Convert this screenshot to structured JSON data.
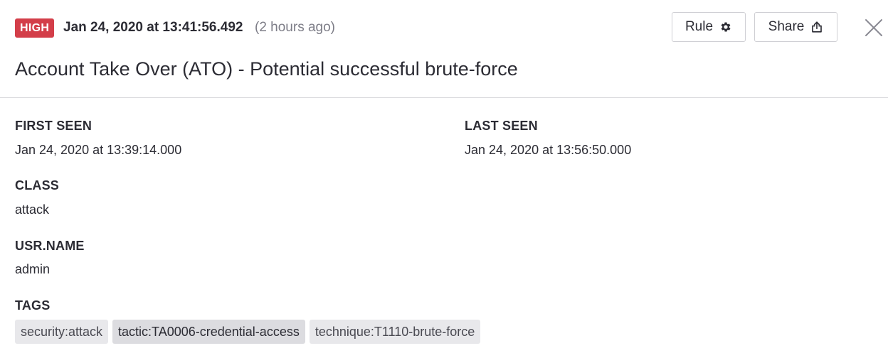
{
  "header": {
    "severity": "HIGH",
    "timestamp": "Jan 24, 2020 at 13:41:56.492",
    "relative_time": "(2 hours ago)",
    "rule_button": "Rule",
    "share_button": "Share",
    "title": "Account Take Over (ATO) - Potential successful brute-force",
    "colors": {
      "severity_high": "#d33e49"
    },
    "icons": {
      "rule": "gear-icon",
      "share": "share-icon",
      "close": "close-icon"
    }
  },
  "fields": {
    "first_seen": {
      "label": "FIRST SEEN",
      "value": "Jan 24, 2020 at 13:39:14.000"
    },
    "last_seen": {
      "label": "LAST SEEN",
      "value": "Jan 24, 2020 at 13:56:50.000"
    },
    "class": {
      "label": "CLASS",
      "value": "attack"
    },
    "usr_name": {
      "label": "USR.NAME",
      "value": "admin"
    },
    "tags": {
      "label": "TAGS",
      "items": [
        "security:attack",
        "tactic:TA0006-credential-access",
        "technique:T1110-brute-force"
      ]
    }
  }
}
